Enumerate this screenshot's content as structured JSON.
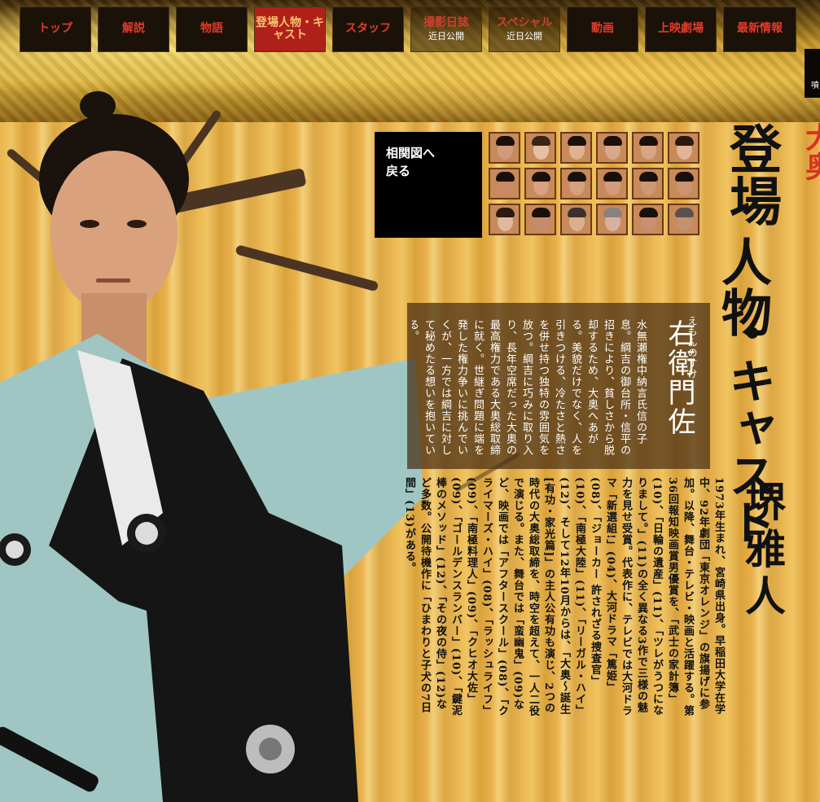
{
  "nav": {
    "items": [
      {
        "label": "トップ",
        "sub": ""
      },
      {
        "label": "解説",
        "sub": ""
      },
      {
        "label": "物語",
        "sub": ""
      },
      {
        "label": "登場人物・キャスト",
        "sub": ""
      },
      {
        "label": "スタッフ",
        "sub": ""
      },
      {
        "label": "撮影日誌",
        "sub": "近日公開"
      },
      {
        "label": "スペシャル",
        "sub": "近日公開"
      },
      {
        "label": "動画",
        "sub": ""
      },
      {
        "label": "上映劇場",
        "sub": ""
      },
      {
        "label": "最新情報",
        "sub": ""
      }
    ],
    "edge_text": "噴"
  },
  "cast_nav": {
    "back_label": "相関図へ\n戻る"
  },
  "title": {
    "part1": "登場",
    "part2": "人物",
    "part3": "・キャスト",
    "corner": "大奥"
  },
  "role": {
    "kana": "えもんのすけ",
    "name": "右衛門佐",
    "description": "水無瀬権中納言氏信の子息。綱吉の御台所・信平の招きにより、貧しさから脱却するため、大奥へあがる。美貌だけでなく、人を引きつける、冷たさと熱さを併せ持つ独特の雰囲気を放つ。綱吉に巧みに取り入り、長年空席だった大奥の最高権力である大奥総取締に就く。世継ぎ問題に端を発した権力争いに挑んでいくが、一方では綱吉に対して秘めたる想いを抱いている。"
  },
  "actor": {
    "name": "堺雅人",
    "bio": "1973年生まれ、宮崎県出身。早稲田大学在学中、92年劇団「東京オレンジ」の旗揚げに参加。以降、舞台・テレビ・映画と活躍する。第36回報知映画賞男優賞を、「武士の家計簿」(10)、「日輪の遺産」(11)、「ツレがうつになりまして。」(11)の全く異なる3作で三様の魅力を見せ受賞。代表作に、テレビでは大河ドラマ「新選組!」(04)、大河ドラマ「篤姫」(08)、「ジョーカー 許されざる捜査官」(10)、「南極大陸」(11)、「リーガル・ハイ」(12)、そして12年10月からは、「大奥～誕生[有功・家光篇]」の主人公有功も演じ、2つの時代の大奥総取締を、時空を超えて、一人二役で演じる。また、舞台では「蛮幽鬼」(09)など、映画では「アフタースクール」(08)、「クライマーズ・ハイ」(08)、「ラッシュライフ」(09)、「南極料理人」(09)、「クヒオ大佐」(09)、「ゴールデンスランバー」(10)、「鍵泥棒のメソッド」(12)、「その夜の侍」(12)など多数。公開待機作に「ひまわりと子犬の7日間」(13)がある。"
  },
  "colors": {
    "nav_bg": "#1a1208",
    "nav_text": "#e23b2b",
    "nav_active_bg": "#b0201a",
    "gold": "#e9b64e",
    "kimono_light": "#9fc6c3",
    "kimono_dark": "#151515"
  }
}
